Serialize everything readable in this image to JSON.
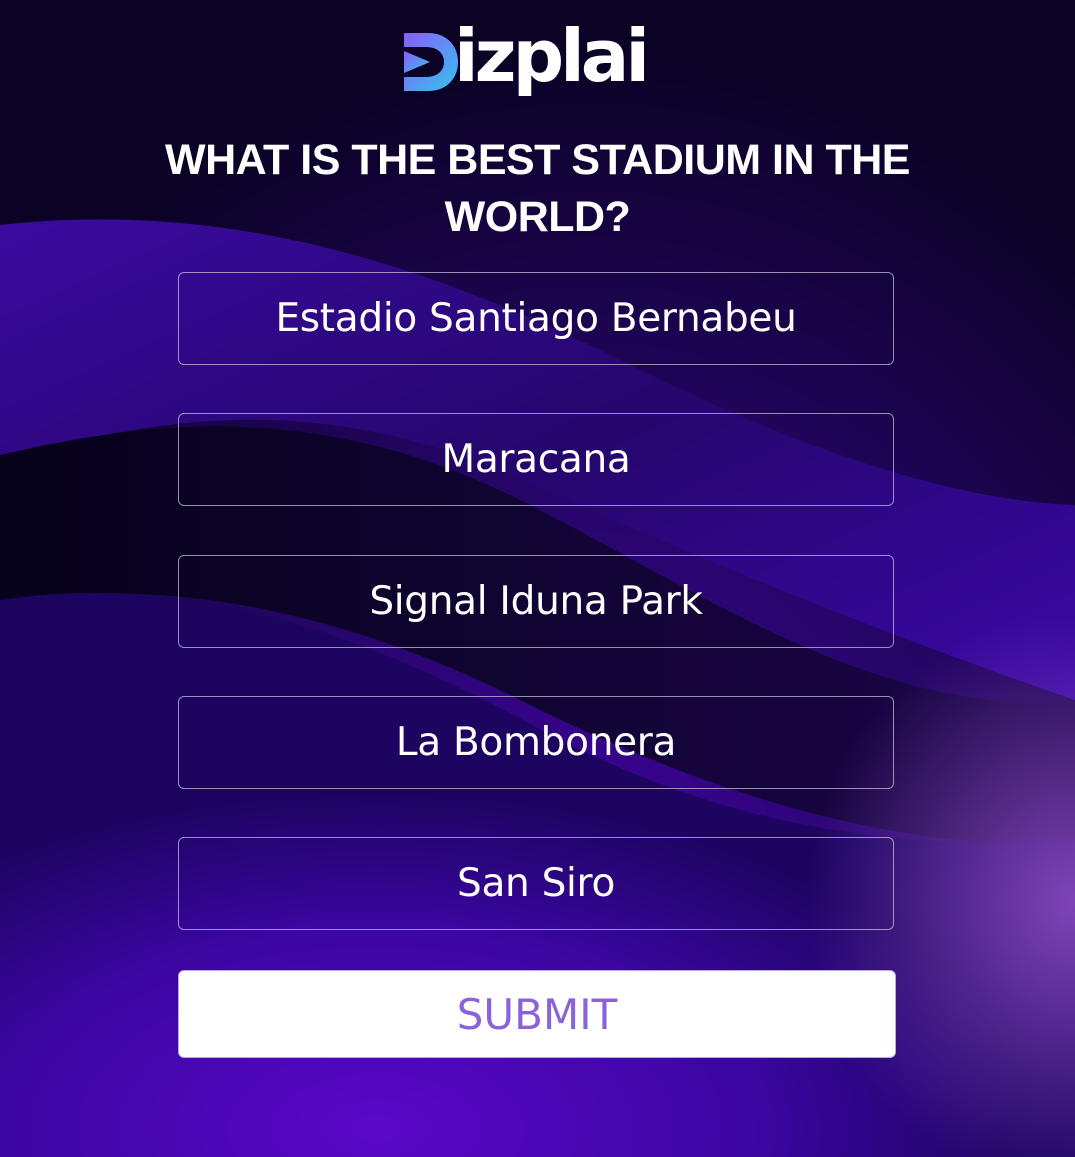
{
  "brand": {
    "name": "Dizplai",
    "logo_text": "izplai",
    "logo_icon": "play-d-icon",
    "accent_gradient": [
      "#7b5cf0",
      "#3cc8f0"
    ]
  },
  "question": {
    "text": "WHAT IS THE BEST STADIUM IN THE WORLD?"
  },
  "options": [
    {
      "label": "Estadio Santiago Bernabeu"
    },
    {
      "label": "Maracana"
    },
    {
      "label": "Signal Iduna Park"
    },
    {
      "label": "La Bombonera"
    },
    {
      "label": "San Siro"
    }
  ],
  "submit": {
    "label": "SUBMIT"
  },
  "colors": {
    "background_dark": "#0a0220",
    "background_purple": "#4a06b0",
    "submit_text": "#8a63d8",
    "text": "#ffffff"
  }
}
